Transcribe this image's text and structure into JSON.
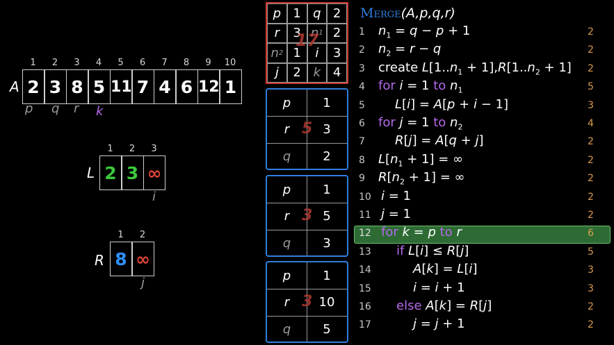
{
  "array_A": {
    "name": "A",
    "indices": [
      "1",
      "2",
      "3",
      "4",
      "5",
      "6",
      "7",
      "8",
      "9",
      "10"
    ],
    "values": [
      "2",
      "3",
      "8",
      "5",
      "11",
      "7",
      "4",
      "6",
      "12",
      "1"
    ],
    "pointers": [
      {
        "label": "p",
        "color": "#9a9a9a"
      },
      {
        "label": "q",
        "color": "#9a9a9a"
      },
      {
        "label": "r",
        "color": "#9a9a9a"
      },
      {
        "label": "k",
        "color": "#b468e8"
      }
    ]
  },
  "array_L": {
    "name": "L",
    "indices": [
      "1",
      "2",
      "3"
    ],
    "values": [
      "2",
      "3",
      "∞"
    ],
    "value_colors": [
      "#3cc83c",
      "#3cc83c",
      "#e0443a"
    ],
    "pointer": "i"
  },
  "array_R": {
    "name": "R",
    "indices": [
      "1",
      "2"
    ],
    "values": [
      "8",
      "∞"
    ],
    "value_colors": [
      "#2f8fff",
      "#e0443a"
    ],
    "pointer": "j"
  },
  "top_table": {
    "cells": [
      "p",
      "1",
      "q",
      "2",
      "r",
      "3",
      "n1",
      "2",
      "n2",
      "1",
      "i",
      "3",
      "j",
      "2",
      "k",
      "4"
    ],
    "scribble": "17"
  },
  "stack_frames": [
    {
      "rows": [
        {
          "k": "p",
          "v": "1"
        },
        {
          "k": "r",
          "v": "3"
        },
        {
          "k": "q",
          "v": "2"
        }
      ],
      "scribble": "5"
    },
    {
      "rows": [
        {
          "k": "p",
          "v": "1"
        },
        {
          "k": "r",
          "v": "5"
        },
        {
          "k": "q",
          "v": "3"
        }
      ],
      "scribble": "3"
    },
    {
      "rows": [
        {
          "k": "p",
          "v": "1"
        },
        {
          "k": "r",
          "v": "10"
        },
        {
          "k": "q",
          "v": "5"
        }
      ],
      "scribble": "3"
    }
  ],
  "code": {
    "title": "Merge",
    "args": "(A,p,q,r)",
    "highlight_line": 12,
    "lines": [
      {
        "n": "1",
        "cost": "2"
      },
      {
        "n": "2",
        "cost": "2"
      },
      {
        "n": "3",
        "cost": "2"
      },
      {
        "n": "4",
        "cost": "5"
      },
      {
        "n": "5",
        "cost": "3"
      },
      {
        "n": "6",
        "cost": "4"
      },
      {
        "n": "7",
        "cost": "2"
      },
      {
        "n": "8",
        "cost": "2"
      },
      {
        "n": "9",
        "cost": "2"
      },
      {
        "n": "10",
        "cost": "2"
      },
      {
        "n": "11",
        "cost": "2"
      },
      {
        "n": "12",
        "cost": "6"
      },
      {
        "n": "13",
        "cost": "5"
      },
      {
        "n": "14",
        "cost": "3"
      },
      {
        "n": "15",
        "cost": "3"
      },
      {
        "n": "16",
        "cost": "2"
      },
      {
        "n": "17",
        "cost": "2"
      }
    ]
  },
  "colors": {
    "keyword": "#b468e8",
    "title": "#2f7fe0",
    "highlight": "#2e6b34",
    "cost": "#d99a4e",
    "frame_border": "#2f7fe0",
    "top_border": "#c9372c"
  }
}
